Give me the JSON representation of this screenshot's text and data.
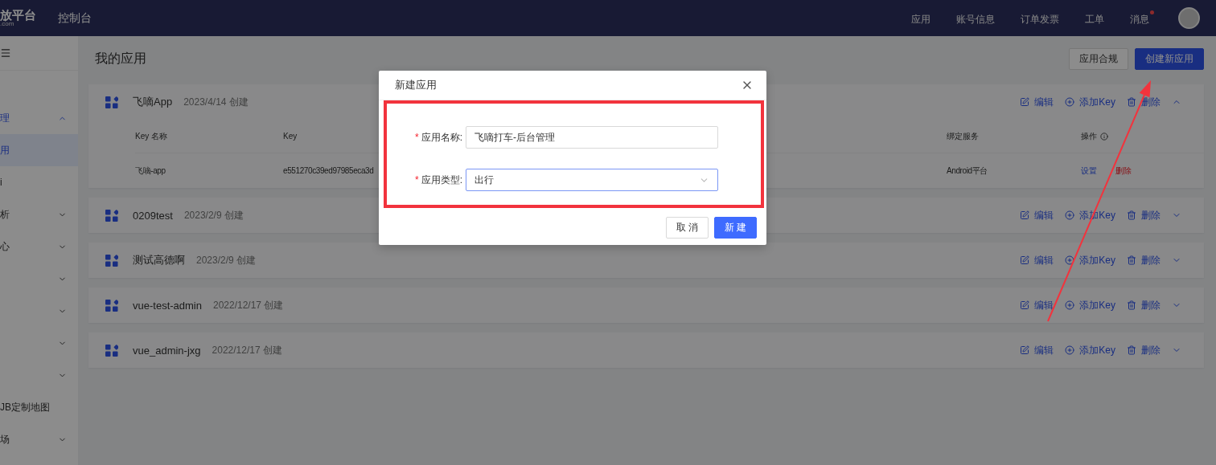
{
  "header": {
    "logo": "放平台",
    "logo_sub": ".com",
    "title": "控制台",
    "nav": [
      {
        "label": "应用",
        "unread": false
      },
      {
        "label": "账号信息",
        "unread": false
      },
      {
        "label": "订单发票",
        "unread": false
      },
      {
        "label": "工单",
        "unread": false
      },
      {
        "label": "消息",
        "unread": true
      }
    ]
  },
  "sidebar": {
    "items": [
      {
        "label": "理",
        "expanded": true,
        "selected": false
      },
      {
        "label": "用",
        "selected": true
      },
      {
        "label": "i",
        "selected": false
      },
      {
        "label": "析",
        "expanded": false,
        "selected": false
      },
      {
        "label": "心",
        "expanded": false,
        "selected": false
      },
      {
        "expanded": false,
        "selected": false
      },
      {
        "expanded": false,
        "selected": false
      },
      {
        "expanded": false,
        "selected": false
      },
      {
        "expanded": false,
        "selected": false
      },
      {
        "label": "JB定制地图",
        "selected": false
      },
      {
        "label": "场",
        "expanded": false,
        "selected": false
      }
    ]
  },
  "page": {
    "title": "我的应用",
    "buttons": [
      {
        "label": "应用合规",
        "kind": "default"
      },
      {
        "label": "创建新应用",
        "kind": "primary"
      }
    ]
  },
  "apps": [
    {
      "name": "飞嘀App",
      "created": "2023/4/14 创建",
      "expanded": true,
      "actions": [
        "编辑",
        "添加Key",
        "删除"
      ],
      "table": {
        "columns": [
          "Key 名称",
          "Key",
          "绑定服务",
          "操作"
        ],
        "rows": [
          {
            "cells": [
              "飞嘀-app",
              "e551270c39ed97985eca3d",
              "Android平台"
            ],
            "actions": [
              {
                "label": "设置",
                "kind": "normal"
              },
              {
                "label": "删除",
                "kind": "danger"
              }
            ]
          }
        ]
      }
    },
    {
      "name": "0209test",
      "created": "2023/2/9 创建",
      "expanded": false,
      "actions": [
        "编辑",
        "添加Key",
        "删除"
      ]
    },
    {
      "name": "测试高德啊",
      "created": "2023/2/9 创建",
      "expanded": false,
      "actions": [
        "编辑",
        "添加Key",
        "删除"
      ]
    },
    {
      "name": "vue-test-admin",
      "created": "2022/12/17 创建",
      "expanded": false,
      "actions": [
        "编辑",
        "添加Key",
        "删除"
      ]
    },
    {
      "name": "vue_admin-jxg",
      "created": "2022/12/17 创建",
      "expanded": false,
      "actions": [
        "编辑",
        "添加Key",
        "删除"
      ]
    }
  ],
  "dialog": {
    "title": "新建应用",
    "fields": [
      {
        "required_mark": "*",
        "label": "应用名称:",
        "kind": "input",
        "value": "飞嘀打车-后台管理"
      },
      {
        "required_mark": "*",
        "label": "应用类型:",
        "kind": "select",
        "value": "出行"
      }
    ],
    "buttons": [
      {
        "label": "取 消",
        "kind": "default"
      },
      {
        "label": "新 建",
        "kind": "primary"
      }
    ]
  }
}
